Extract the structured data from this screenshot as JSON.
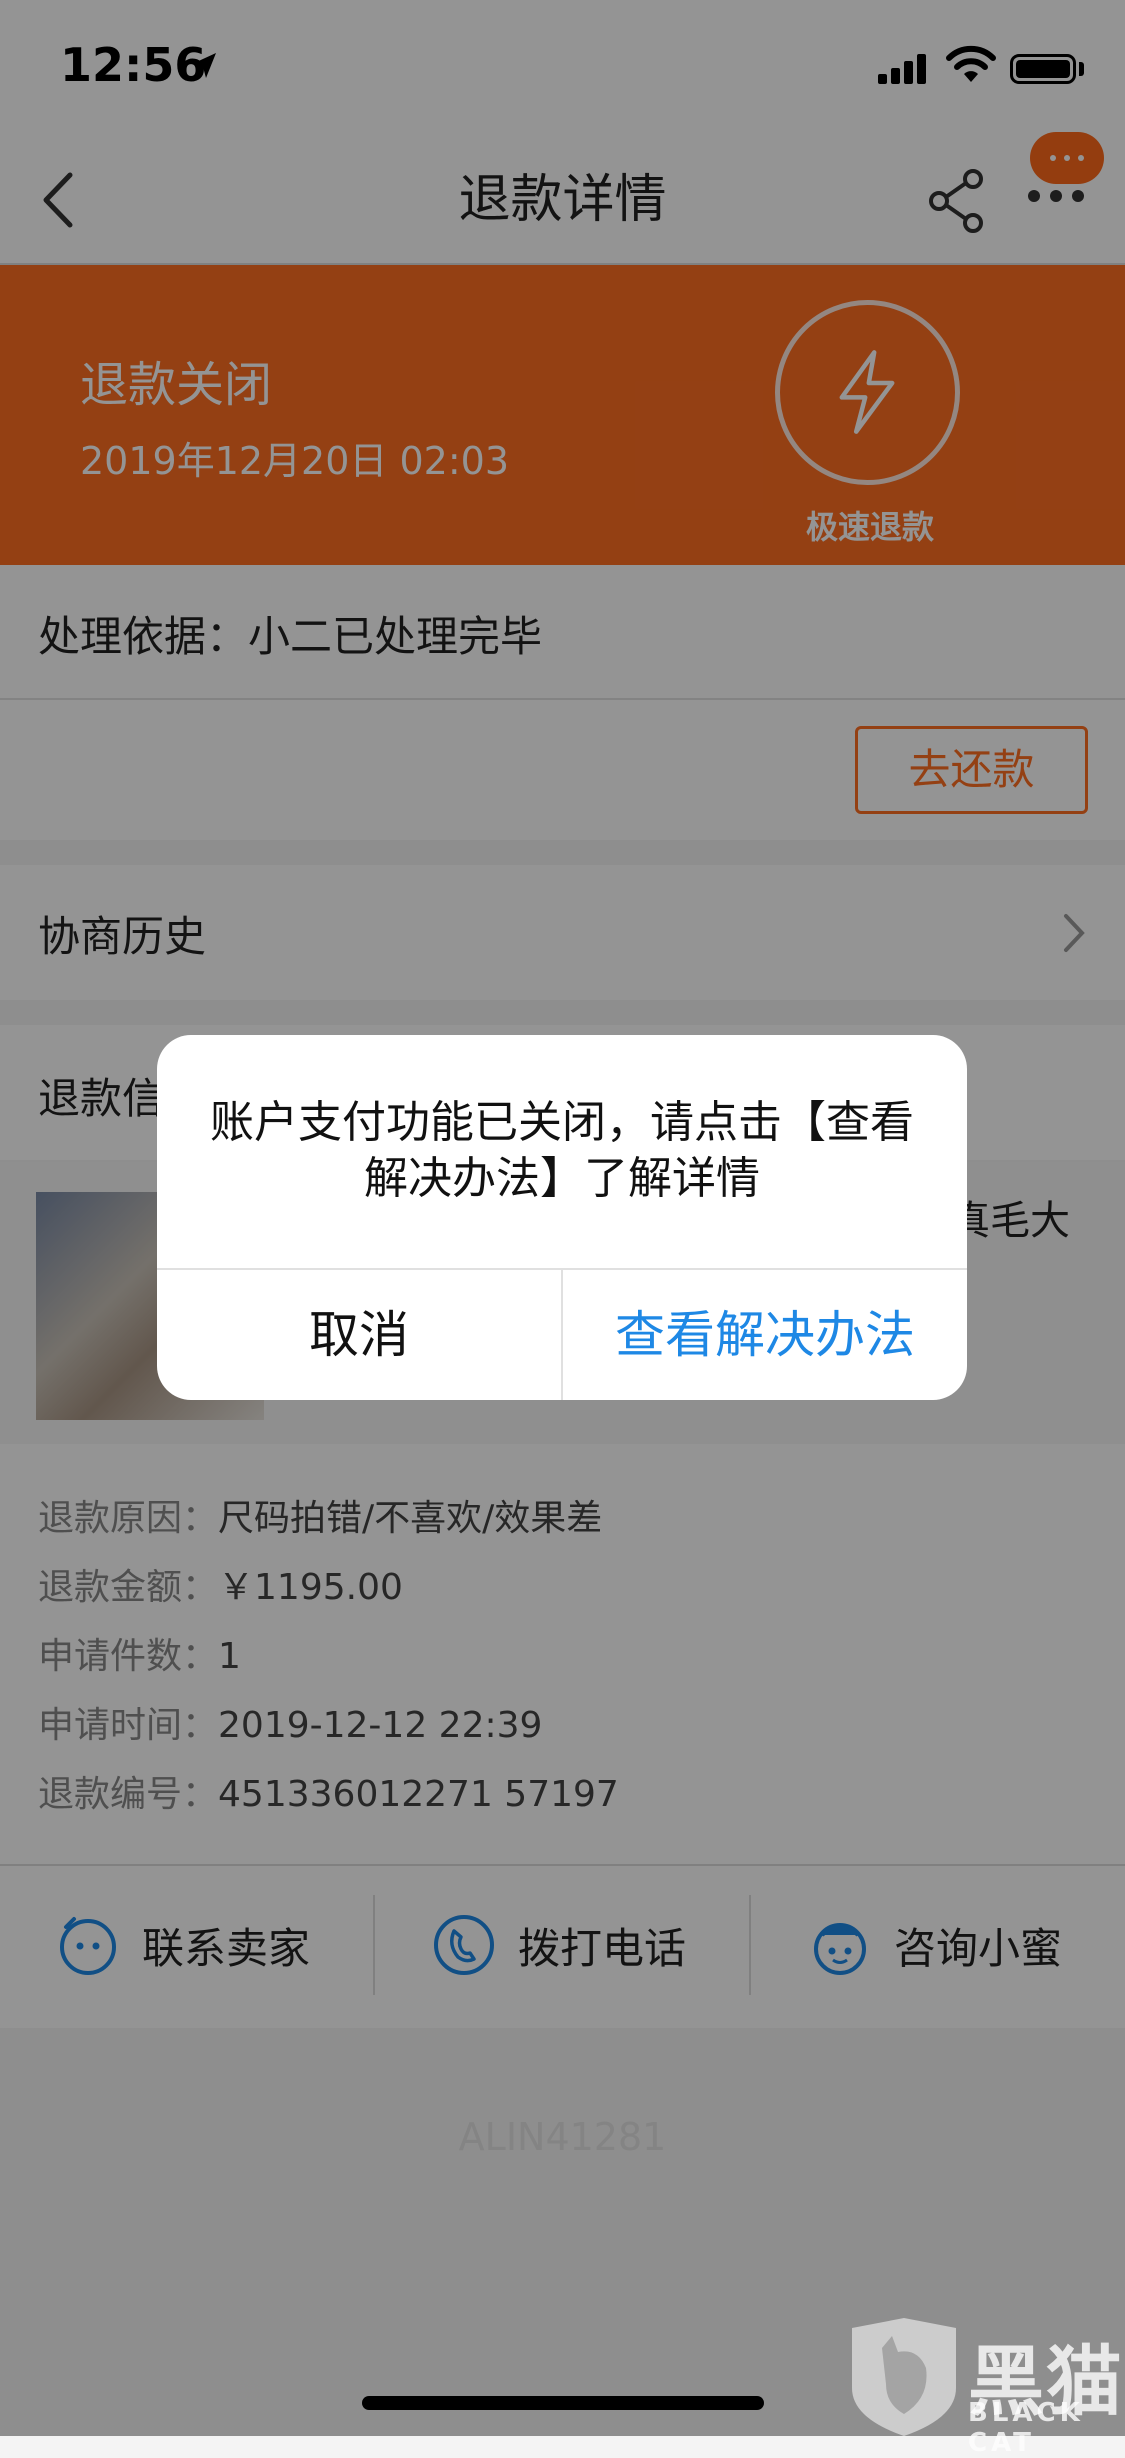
{
  "status_bar": {
    "time": "12:56"
  },
  "nav": {
    "title": "退款详情"
  },
  "header": {
    "status": "退款关闭",
    "date": "2019年12月20日 02:03",
    "fast_refund_label": "极速退款",
    "bg_color": "#ff6e22"
  },
  "basis": {
    "text": "处理依据：小二已处理完毕"
  },
  "repay": {
    "button": "去还款"
  },
  "history": {
    "label": "协商历史"
  },
  "refund_info": {
    "title": "退款信",
    "product_title_fragment": "真毛大"
  },
  "details": [
    {
      "label": "退款原因：",
      "value": "尺码拍错/不喜欢/效果差"
    },
    {
      "label": "退款金额：",
      "value": "￥1195.00"
    },
    {
      "label": "申请件数：",
      "value": "1"
    },
    {
      "label": "申请时间：",
      "value": "2019-12-12 22:39"
    },
    {
      "label": "退款编号：",
      "value": "451336012271 57197"
    }
  ],
  "actions": {
    "contact_seller": "联系卖家",
    "call_phone": "拨打电话",
    "ask_helper": "咨询小蜜"
  },
  "watermark": "ALIN41281",
  "dialog": {
    "message": "账户支付功能已关闭，请点击【查看解决办法】了解详情",
    "cancel": "取消",
    "solve": "查看解决办法"
  },
  "logo": {
    "text": "黑猫",
    "sub": "BLACK CAT"
  },
  "colors": {
    "accent": "#ff6e22",
    "link": "#1e88e5"
  }
}
